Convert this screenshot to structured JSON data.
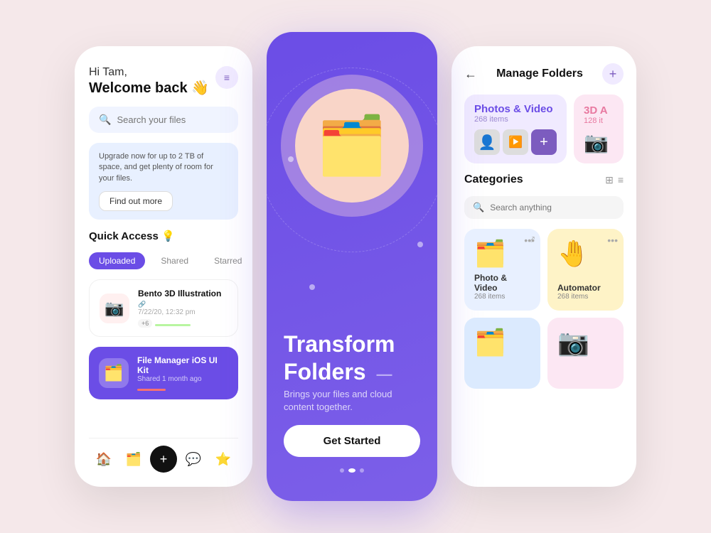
{
  "screen1": {
    "greeting_hi": "Hi Tam,",
    "greeting_welcome": "Welcome back 👋",
    "menu_icon": "≡",
    "search_placeholder": "Search your files",
    "upgrade_text": "Upgrade now for up to 2 TB of space, and get plenty of room for your files.",
    "find_out_btn": "Find out more",
    "quick_access_label": "Quick Access 💡",
    "tabs": [
      "Uploaded",
      "Shared",
      "Starred"
    ],
    "active_tab": 0,
    "files": [
      {
        "name": "Bento 3D Illustration",
        "meta": "7/22/20, 12:32 pm",
        "icon": "📷",
        "icon_bg": "pink",
        "theme": "light",
        "progress_color": "#b8f5a0",
        "avatars": [
          "#f88",
          "#fb8",
          "#bdf"
        ]
      },
      {
        "name": "File Manager iOS UI Kit",
        "meta": "Shared 1 month ago",
        "icon": "🗂️",
        "icon_bg": "purple",
        "theme": "dark",
        "progress_color": "#f87171"
      }
    ],
    "nav_items": [
      "🏠",
      "🗂️",
      "+",
      "💬",
      "⭐"
    ]
  },
  "screen2": {
    "title1": "Transform",
    "title2": "Folders",
    "subtitle": "Brings your files and cloud content together.",
    "get_started": "Get Started",
    "carousel_active": 1
  },
  "screen3": {
    "back_icon": "←",
    "title": "Manage Folders",
    "add_icon": "+",
    "photos_card": {
      "title": "Photos & Video",
      "count": "268 items"
    },
    "three_d_card": {
      "title": "3D A",
      "count": "128 it"
    },
    "categories_title": "Categories",
    "search_placeholder": "Search anything",
    "categories": [
      {
        "name": "Photo & Video",
        "count": "268 items",
        "icon": "🗂️",
        "bg": "blue-light",
        "more": "..."
      },
      {
        "name": "Automator",
        "count": "268 items",
        "icon": "🤚",
        "bg": "yellow",
        "more": "..."
      },
      {
        "name": "",
        "count": "",
        "icon": "🗂️",
        "bg": "blue-light2",
        "more": ""
      },
      {
        "name": "",
        "count": "",
        "icon": "📷",
        "bg": "pink-light",
        "more": ""
      }
    ]
  }
}
